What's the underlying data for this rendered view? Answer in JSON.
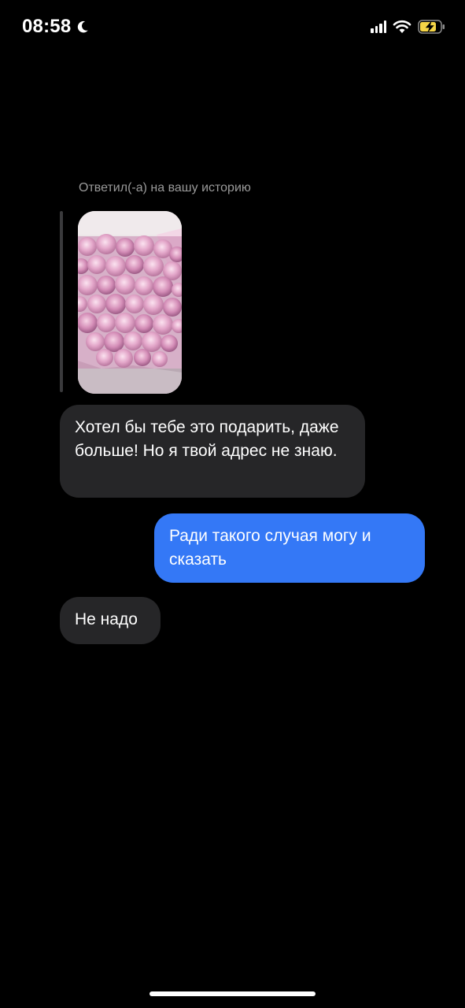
{
  "status_bar": {
    "time": "08:58",
    "icons": [
      "moon-icon",
      "signal-icon",
      "wifi-icon",
      "battery-charging-icon"
    ],
    "battery_color": "#f5d547"
  },
  "chat": {
    "reply_caption": "Ответил(-а) на вашу историю",
    "story_preview": {
      "subject": "bouquet of pink peonies"
    },
    "messages": [
      {
        "direction": "incoming",
        "text": "Хотел бы тебе это подарить, даже больше! Но я твой адрес не знаю."
      },
      {
        "direction": "outgoing",
        "text": "Ради такого случая могу и сказать"
      },
      {
        "direction": "incoming",
        "text": "Не надо"
      }
    ]
  },
  "colors": {
    "background": "#000000",
    "incoming_bubble": "#262628",
    "outgoing_bubble": "#3478f6",
    "caption": "#9a9a9a"
  }
}
